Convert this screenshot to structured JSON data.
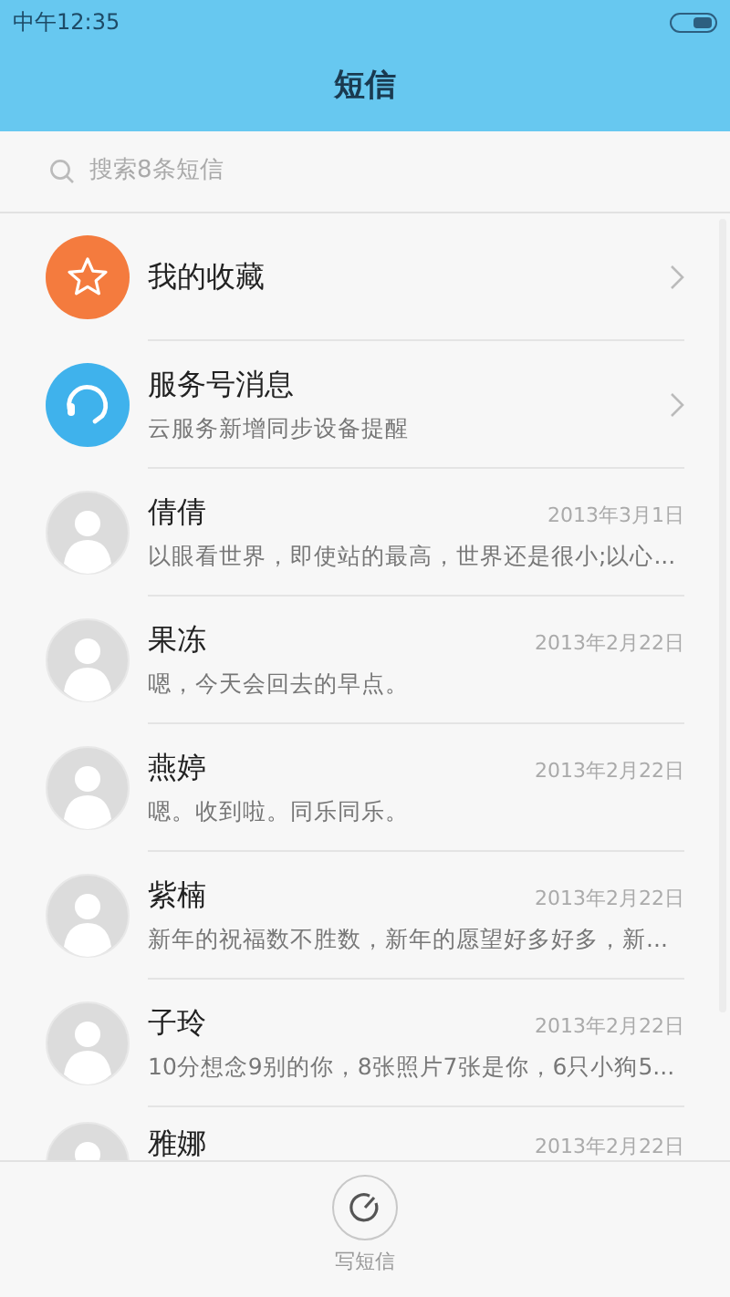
{
  "status_bar": {
    "time": "中午12:35"
  },
  "title": "短信",
  "search": {
    "placeholder": "搜索8条短信"
  },
  "conversations": [
    {
      "kind": "favorite",
      "name": "我的收藏"
    },
    {
      "kind": "service",
      "name": "服务号消息",
      "preview": "云服务新增同步设备提醒"
    },
    {
      "kind": "contact",
      "name": "倩倩",
      "date": "2013年3月1日",
      "preview": "以眼看世界，即使站的最高，世界还是很小;以心..."
    },
    {
      "kind": "contact",
      "name": "果冻",
      "date": "2013年2月22日",
      "preview": "嗯，今天会回去的早点。"
    },
    {
      "kind": "contact",
      "name": "燕婷",
      "date": "2013年2月22日",
      "preview": "嗯。收到啦。同乐同乐。"
    },
    {
      "kind": "contact",
      "name": "紫楠",
      "date": "2013年2月22日",
      "preview": "新年的祝福数不胜数，新年的愿望好多好多，新..."
    },
    {
      "kind": "contact",
      "name": "子玲",
      "date": "2013年2月22日",
      "preview": "10分想念9别的你，8张照片7张是你，6只小狗5..."
    },
    {
      "kind": "contact",
      "name": "雅娜",
      "date": "2013年2月22日"
    }
  ],
  "compose": {
    "label": "写短信"
  }
}
